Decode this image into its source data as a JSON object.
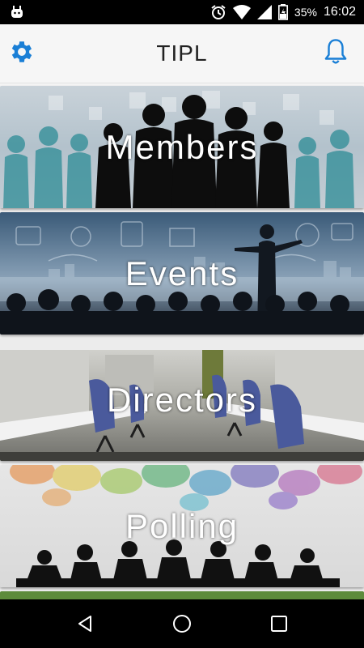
{
  "status_bar": {
    "battery_percent": "35%",
    "time": "16:02",
    "icons": [
      "android-icon",
      "alarm-icon",
      "wifi-icon",
      "signal-icon",
      "battery-icon"
    ]
  },
  "app_bar": {
    "title": "TIPL",
    "settings_icon": "gear-icon",
    "notifications_icon": "bell-icon",
    "accent_color": "#1a7fd6"
  },
  "menu": {
    "items": [
      {
        "label": "Members"
      },
      {
        "label": "Events"
      },
      {
        "label": "Directors"
      },
      {
        "label": "Polling"
      }
    ]
  },
  "nav_bar": {
    "icons": [
      "back-icon",
      "home-icon",
      "recents-icon"
    ]
  }
}
